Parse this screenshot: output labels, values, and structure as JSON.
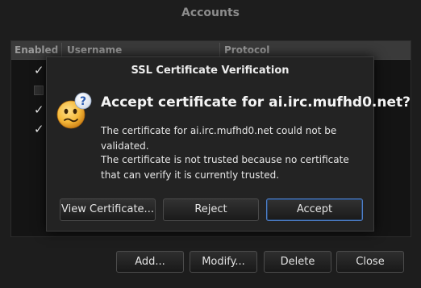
{
  "accounts_window": {
    "title": "Accounts",
    "columns": [
      "Enabled",
      "Username",
      "Protocol"
    ],
    "rows": [
      {
        "enabled": true
      },
      {
        "enabled": false
      },
      {
        "enabled": true
      },
      {
        "enabled": true
      }
    ],
    "check_glyph": "✓",
    "buttons": {
      "add": "Add...",
      "modify": "Modify...",
      "delete": "Delete",
      "close": "Close"
    }
  },
  "dialog": {
    "title": "SSL Certificate Verification",
    "icon": "confused-smiley-icon",
    "heading": "Accept certificate for ai.irc.mufhd0.net?",
    "message_1": "The certificate for ai.irc.mufhd0.net could not be validated.",
    "message_2": "The certificate is not trusted because no certificate that can verify it is currently trusted.",
    "buttons": {
      "view": "View Certificate...",
      "reject": "Reject",
      "accept": "Accept"
    },
    "default_button": "accept",
    "accent_color": "#4e7fc8"
  }
}
